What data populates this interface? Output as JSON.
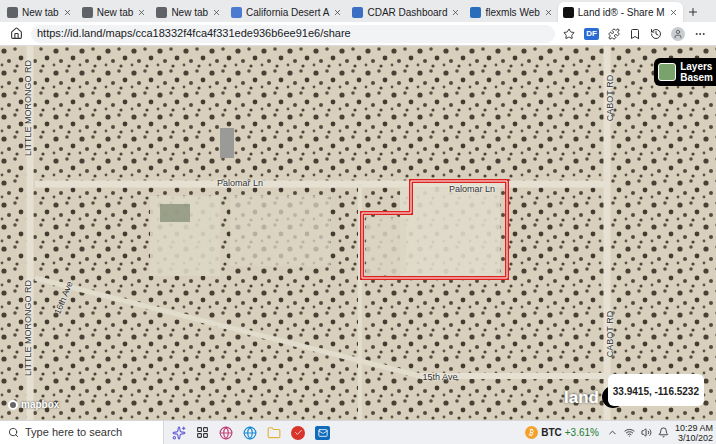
{
  "browser": {
    "tabs": [
      {
        "label": "New tab",
        "selected": false,
        "color": "#5f6368"
      },
      {
        "label": "New tab",
        "selected": false,
        "color": "#5f6368"
      },
      {
        "label": "New tab",
        "selected": false,
        "color": "#5f6368"
      },
      {
        "label": "California Desert A",
        "selected": false,
        "color": "#4a7bd0"
      },
      {
        "label": "CDAR Dashboard",
        "selected": false,
        "color": "#3b6fc4"
      },
      {
        "label": "flexmls Web",
        "selected": false,
        "color": "#2a6ebb"
      },
      {
        "label": "Land id® - Share M",
        "selected": true,
        "color": "#111111"
      }
    ],
    "address": "https://id.land/maps/cca18332f4fca4f331ede936b6ee91e6/share",
    "extension_badge": "DF"
  },
  "map": {
    "labels": [
      {
        "text": "Palomar Ln",
        "kind": "horizontal"
      },
      {
        "text": "Palomar Ln",
        "kind": "horizontal"
      },
      {
        "text": "LITTLE MORONGO RD",
        "kind": "vertical"
      },
      {
        "text": "LITTLE MORONGO RD",
        "kind": "vertical"
      },
      {
        "text": "CABOT RD",
        "kind": "vertical"
      },
      {
        "text": "CABOT RD",
        "kind": "vertical"
      },
      {
        "text": "16th Ave",
        "kind": "angled"
      },
      {
        "text": "15th Ave",
        "kind": "horizontal"
      }
    ],
    "layers_button": {
      "title": "Layers",
      "subtitle": "Basem"
    },
    "attribution": "mapbox",
    "brand": "land",
    "brand_mark": "id",
    "coordinates": "33.9415, -116.5232"
  },
  "taskbar": {
    "search_placeholder": "Type here to search",
    "ticker": "BTC",
    "change": "+3.61%",
    "time": "10:29 AM",
    "date": "3/10/202"
  }
}
